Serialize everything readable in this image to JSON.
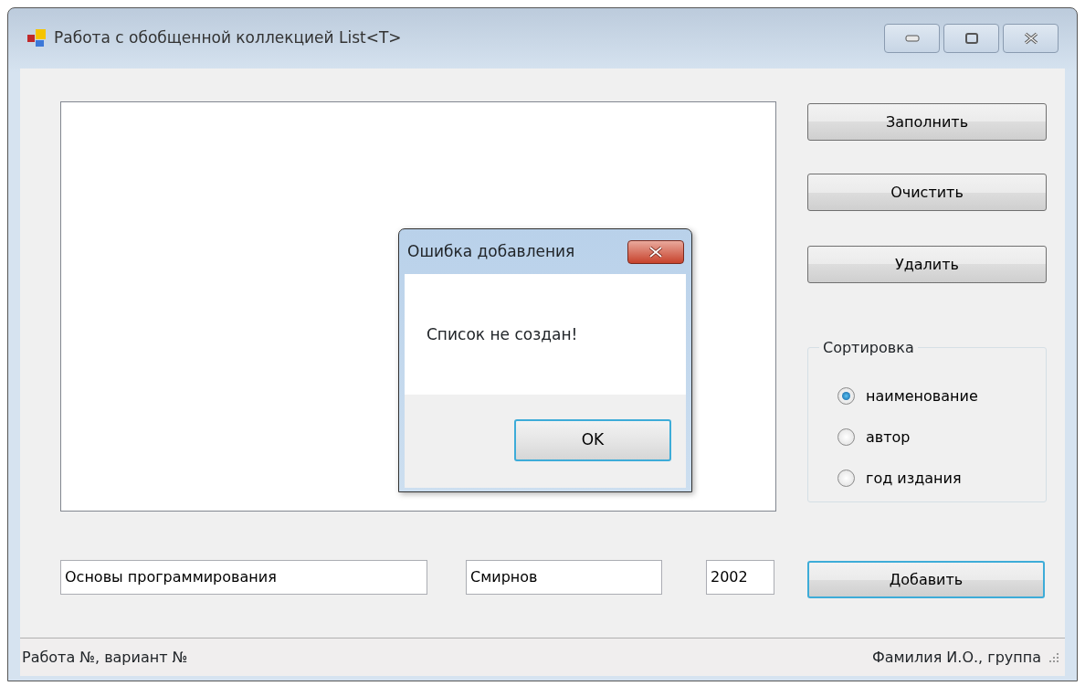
{
  "window": {
    "title": "Работа с обобщенной коллекцией List<T>"
  },
  "actions": [
    "Заполнить",
    "Очистить",
    "Удалить"
  ],
  "sort": {
    "title": "Сортировка",
    "options": [
      {
        "label": "наименование",
        "selected": true
      },
      {
        "label": "автор",
        "selected": false
      },
      {
        "label": "год издания",
        "selected": false
      }
    ]
  },
  "fields": [
    {
      "value": "Основы программирования"
    },
    {
      "value": "Смирнов"
    },
    {
      "value": "2002"
    }
  ],
  "add_button": "Добавить",
  "status_bar": {
    "left": "Работа №, вариант №",
    "right": "Фамилия И.О., группа"
  },
  "dialog": {
    "title": "Ошибка добавления",
    "message": "Список не создан!",
    "button": "OK"
  }
}
